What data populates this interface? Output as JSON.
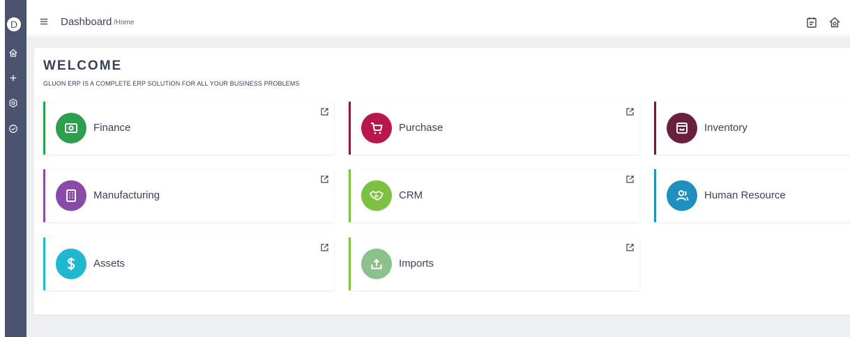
{
  "sidebar": {
    "avatar_letter": "D",
    "icons": [
      "home-icon",
      "plus-icon",
      "settings-icon",
      "check-circle-icon"
    ]
  },
  "header": {
    "title": "Dashboard",
    "breadcrumb": "/Home",
    "icons": [
      "menu-icon",
      "calendar-icon",
      "home-icon"
    ]
  },
  "main": {
    "welcome": "WELCOME",
    "tagline": "GLUON ERP IS A COMPLETE ERP SOLUTION FOR ALL YOUR BUSINESS PROBLEMS",
    "modules": [
      {
        "label": "Finance",
        "icon": "money-icon",
        "color": "#2e9e4f"
      },
      {
        "label": "Purchase",
        "icon": "cart-icon",
        "color": "#b8174a"
      },
      {
        "label": "Inventory",
        "icon": "archive-box-icon",
        "color": "#6b1f3e"
      },
      {
        "label": "Manufacturing",
        "icon": "building-icon",
        "color": "#8a4aa8"
      },
      {
        "label": "CRM",
        "icon": "handshake-icon",
        "color": "#7cc142"
      },
      {
        "label": "Human Resource",
        "icon": "users-icon",
        "color": "#1f8fbf"
      },
      {
        "label": "Assets",
        "icon": "dollar-icon",
        "color": "#1fb8cf"
      },
      {
        "label": "Imports",
        "icon": "upload-icon",
        "color": "#8cc08c"
      }
    ]
  },
  "colors": {
    "sidebar": "#4a5470",
    "text": "#3a4257",
    "background": "#eef0f2"
  }
}
